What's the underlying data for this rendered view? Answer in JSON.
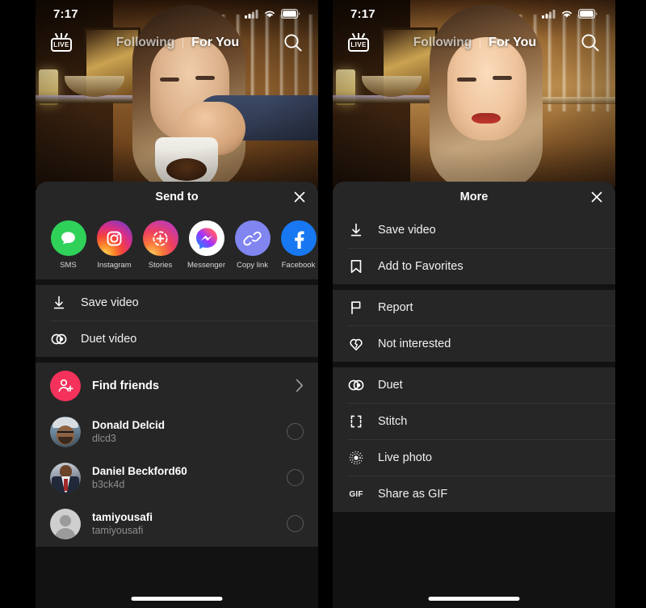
{
  "status_bar": {
    "time": "7:17",
    "cellular_icon": "signal-bars-icon",
    "wifi_icon": "wifi-icon",
    "battery_icon": "battery-icon"
  },
  "nav": {
    "live_label": "LIVE",
    "following_label": "Following",
    "for_you_label": "For You",
    "search_icon": "search-icon",
    "active_tab": "For You"
  },
  "left_panel": {
    "sheet": {
      "title": "Send to",
      "close_icon": "close-icon",
      "share_targets": [
        {
          "label": "SMS",
          "icon": "sms-icon",
          "color": "#2fd159"
        },
        {
          "label": "Instagram",
          "icon": "instagram-icon",
          "color": "#da2e85"
        },
        {
          "label": "Stories",
          "icon": "stories-icon",
          "color": "#ef3f5e"
        },
        {
          "label": "Messenger",
          "icon": "messenger-icon",
          "color": "#ffffff"
        },
        {
          "label": "Copy link",
          "icon": "link-icon",
          "color": "#8085f0"
        },
        {
          "label": "Facebook",
          "icon": "facebook-icon",
          "color": "#1778f2"
        }
      ],
      "actions": [
        {
          "label": "Save video",
          "icon": "download-icon"
        },
        {
          "label": "Duet video",
          "icon": "duet-icon"
        }
      ],
      "find_friends": {
        "label": "Find friends",
        "icon": "add-person-icon",
        "chevron_icon": "chevron-right-icon",
        "color": "#f5325b"
      },
      "friends": [
        {
          "name": "Donald Delcid",
          "handle": "dlcd3",
          "avatar": "avatar-donald",
          "selected": false
        },
        {
          "name": "Daniel Beckford60",
          "handle": "b3ck4d",
          "avatar": "avatar-daniel",
          "selected": false
        },
        {
          "name": "tamiyousafi",
          "handle": "tamiyousafi",
          "avatar": "avatar-tami",
          "selected": false
        }
      ]
    }
  },
  "right_panel": {
    "sheet": {
      "title": "More",
      "close_icon": "close-icon",
      "group_1": [
        {
          "label": "Save video",
          "icon": "download-icon"
        },
        {
          "label": "Add to Favorites",
          "icon": "bookmark-icon"
        }
      ],
      "group_2": [
        {
          "label": "Report",
          "icon": "flag-icon"
        },
        {
          "label": "Not interested",
          "icon": "broken-heart-icon"
        }
      ],
      "group_3": [
        {
          "label": "Duet",
          "icon": "duet-icon"
        },
        {
          "label": "Stitch",
          "icon": "stitch-icon"
        },
        {
          "label": "Live photo",
          "icon": "live-photo-icon"
        },
        {
          "label": "Share as GIF",
          "icon": "gif-icon"
        }
      ]
    }
  },
  "colors": {
    "sheet_background": "#121212",
    "row_background": "#262626",
    "divider": "#343434",
    "text_primary": "#f1f1f1",
    "text_secondary": "#8e8e8e",
    "accent_pink": "#f5325b"
  },
  "gif_badge_text": "GIF"
}
